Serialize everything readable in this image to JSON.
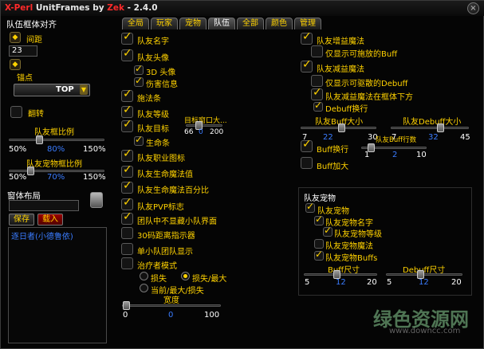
{
  "window": {
    "title_prefix": "X-Perl",
    "title_mid": " UnitFrames by ",
    "title_author": "Zek",
    "title_version": " - 2.4.0",
    "close_glyph": "×"
  },
  "tabs": [
    "全局",
    "玩家",
    "宠物",
    "队伍",
    "全部",
    "颜色",
    "管理"
  ],
  "left": {
    "section_title": "队伍框体对齐",
    "spacing_label": "间距",
    "spacing_value": "23",
    "anchor_label": "锚点",
    "anchor_value": "TOP",
    "flip_label": "翻转",
    "frame_scale_label": "队友框比例",
    "frame_scale": {
      "min": "50%",
      "value": "80%",
      "max": "150%",
      "fraction": 0.3
    },
    "pet_scale_label": "队友宠物框比例",
    "pet_scale": {
      "min": "50%",
      "value": "70%",
      "max": "150%",
      "fraction": 0.2
    },
    "layout_label": "窗体布局",
    "save_label": "保存",
    "load_label": "载入",
    "layouts": [
      "逐日者(小德鲁依)"
    ]
  },
  "middle": {
    "items": [
      {
        "label": "队友名字",
        "checked": true
      },
      {
        "label": "队友头像",
        "checked": true
      },
      {
        "label": "3D 头像",
        "checked": true
      },
      {
        "label": "伤害信息",
        "checked": true
      },
      {
        "label": "施法条",
        "checked": true
      },
      {
        "label": "队友等级",
        "checked": true
      },
      {
        "label": "队友目标",
        "checked": true
      },
      {
        "label": "生命条",
        "checked": true
      },
      {
        "label": "队友职业图标",
        "checked": true
      },
      {
        "label": "队友生命魔法值",
        "checked": true
      },
      {
        "label": "队友生命魔法百分比",
        "checked": true
      },
      {
        "label": "队友PVP标志",
        "checked": true
      },
      {
        "label": "团队中不显藏小队界面",
        "checked": true
      },
      {
        "label": "30码距离指示器",
        "checked": false
      },
      {
        "label": "单小队团队显示",
        "checked": false
      },
      {
        "label": "治疗者模式",
        "checked": false
      }
    ],
    "target_interval": {
      "label": "目标窗口大...",
      "min": "66",
      "value": "0",
      "max": "200",
      "fraction": 0.3
    },
    "healer_options": [
      {
        "label": "损失",
        "selected": false
      },
      {
        "label": "损失/最大",
        "selected": true
      },
      {
        "label": "当前/最大/损失",
        "selected": false
      }
    ],
    "width": {
      "label": "宽度",
      "min": "0",
      "value": "0",
      "max": "100",
      "fraction": 0.0
    }
  },
  "right": {
    "buffs_label": "队友增益魔法",
    "buffs_castable_label": "仅显示可施放的Buff",
    "debuffs_label": "队友减益魔法",
    "debuffs_dispel_label": "仅显示可驱散的Debuff",
    "debuffs_below_label": "队友减益魔法在框体下方",
    "debuff_wrap_label": "Debuff换行",
    "buff_size": {
      "label": "队友Buff大小",
      "min": "7",
      "value": "22",
      "max": "30",
      "fraction": 0.55
    },
    "debuff_size": {
      "label": "队友Debuff大小",
      "min": "7",
      "value": "32",
      "max": "45",
      "fraction": 0.65
    },
    "buff_wrap_label": "Buff换行",
    "buff_rows": {
      "label": "队友Buff行数",
      "min": "1",
      "value": "2",
      "max": "10",
      "fraction": 0.1
    },
    "buff_enlarge_label": "Buff加大"
  },
  "pet": {
    "title": "队友宠物",
    "pets_label": "队友宠物",
    "pet_name_label": "队友宠物名字",
    "pet_level_label": "队友宠物等级",
    "pet_magic_label": "队友宠物魔法",
    "pet_buffs_label": "队友宠物Buffs",
    "buff_size": {
      "label": "Buff尺寸",
      "min": "5",
      "value": "12",
      "max": "20",
      "fraction": 0.45
    },
    "debuff_size": {
      "label": "Debuff尺寸",
      "min": "5",
      "value": "12",
      "max": "20",
      "fraction": 0.45
    }
  },
  "watermark": {
    "logo": "绿色资源网",
    "url": "www.downcc.com"
  }
}
